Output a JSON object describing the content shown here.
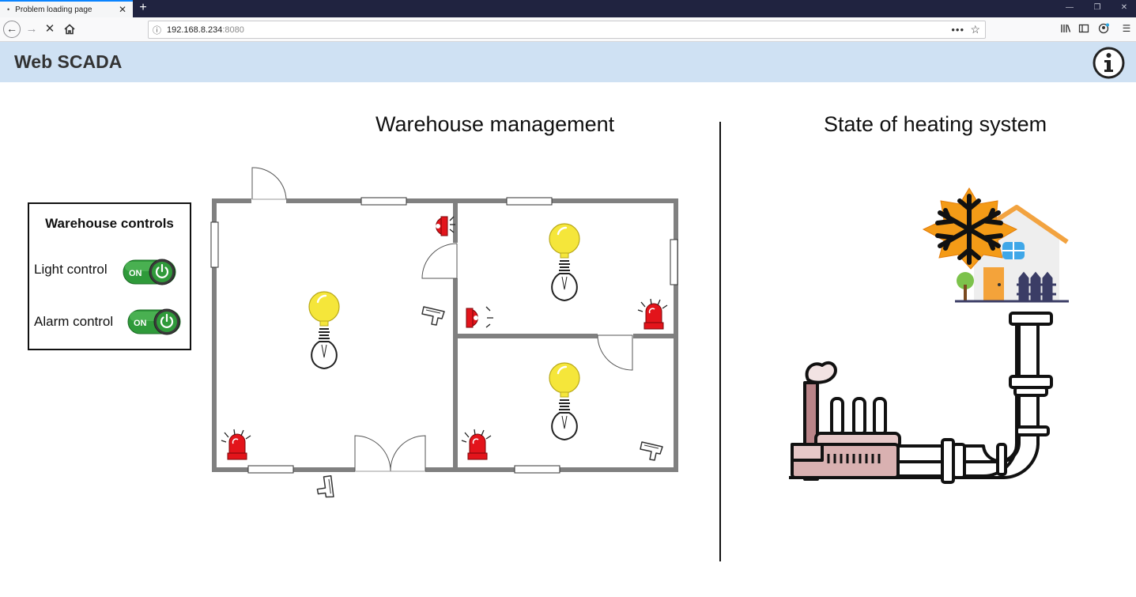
{
  "browser": {
    "tab_title": "Problem loading page",
    "tab_dot": "•",
    "tab_close": "✕",
    "new_tab": "+",
    "url_host": "192.168.8.234",
    "url_port": ":8080",
    "icons": [
      "back-arrow-icon",
      "forward-arrow-icon",
      "stop-icon",
      "home-icon",
      "info-icon",
      "page-actions-icon",
      "bookmark-star-icon",
      "library-icon",
      "sidebar-icon",
      "account-icon",
      "menu-icon"
    ]
  },
  "app": {
    "title": "Web SCADA"
  },
  "warehouse": {
    "title": "Warehouse management",
    "controls": {
      "title": "Warehouse controls",
      "light_label": "Light control",
      "light_state": "ON",
      "alarm_label": "Alarm control",
      "alarm_state": "ON"
    }
  },
  "heating": {
    "title": "State of heating system"
  },
  "colors": {
    "header_bg": "#cfe1f3",
    "wall": "#808080",
    "bulb": "#f5e63a",
    "alarm": "#e3141b",
    "toggle_green": "#2f9a3a",
    "snow_orange": "#f49b17"
  }
}
